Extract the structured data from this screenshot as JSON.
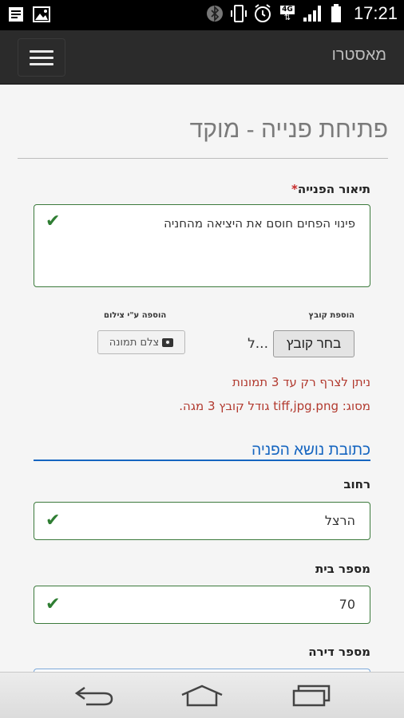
{
  "status_bar": {
    "time": "17:21",
    "network_label": "4G",
    "icons": [
      "notes-icon",
      "image-icon",
      "bluetooth-icon",
      "vibrate-icon",
      "alarm-icon",
      "network-4g-icon",
      "signal-icon",
      "battery-icon"
    ]
  },
  "app_bar": {
    "title": "מאסטרו",
    "menu_icon": "hamburger-menu-icon"
  },
  "page": {
    "title": "פתיחת פנייה - מוקד"
  },
  "form": {
    "description_label": "תיאור הפנייה",
    "required_mark": "*",
    "description_value": "פינוי הפחים חוסם את היציאה מהחניה",
    "add_file_label": "הוספת קובץ",
    "choose_file_button": "בחר קובץ",
    "file_ellipsis": "ל...",
    "add_photo_label": "הוספה ע\"י צילום",
    "take_photo_button": "צלם תמונה",
    "note_line1": "ניתן לצרף רק עד 3 תמונות",
    "note_line2": "מסוג: tiff,jpg.png גודל קובץ 3 מגה.",
    "address_section_title": "כתובת נושא הפניה",
    "street_label": "רחוב",
    "street_value": "הרצל",
    "house_number_label": "מספר בית",
    "house_number_value": "70",
    "apartment_label": "מספר דירה"
  },
  "colors": {
    "valid_border": "#3c7a3c",
    "check": "#2e7d32",
    "note": "#b23a2f",
    "section_accent": "#1565c0",
    "app_bar": "#2b2b2b"
  }
}
